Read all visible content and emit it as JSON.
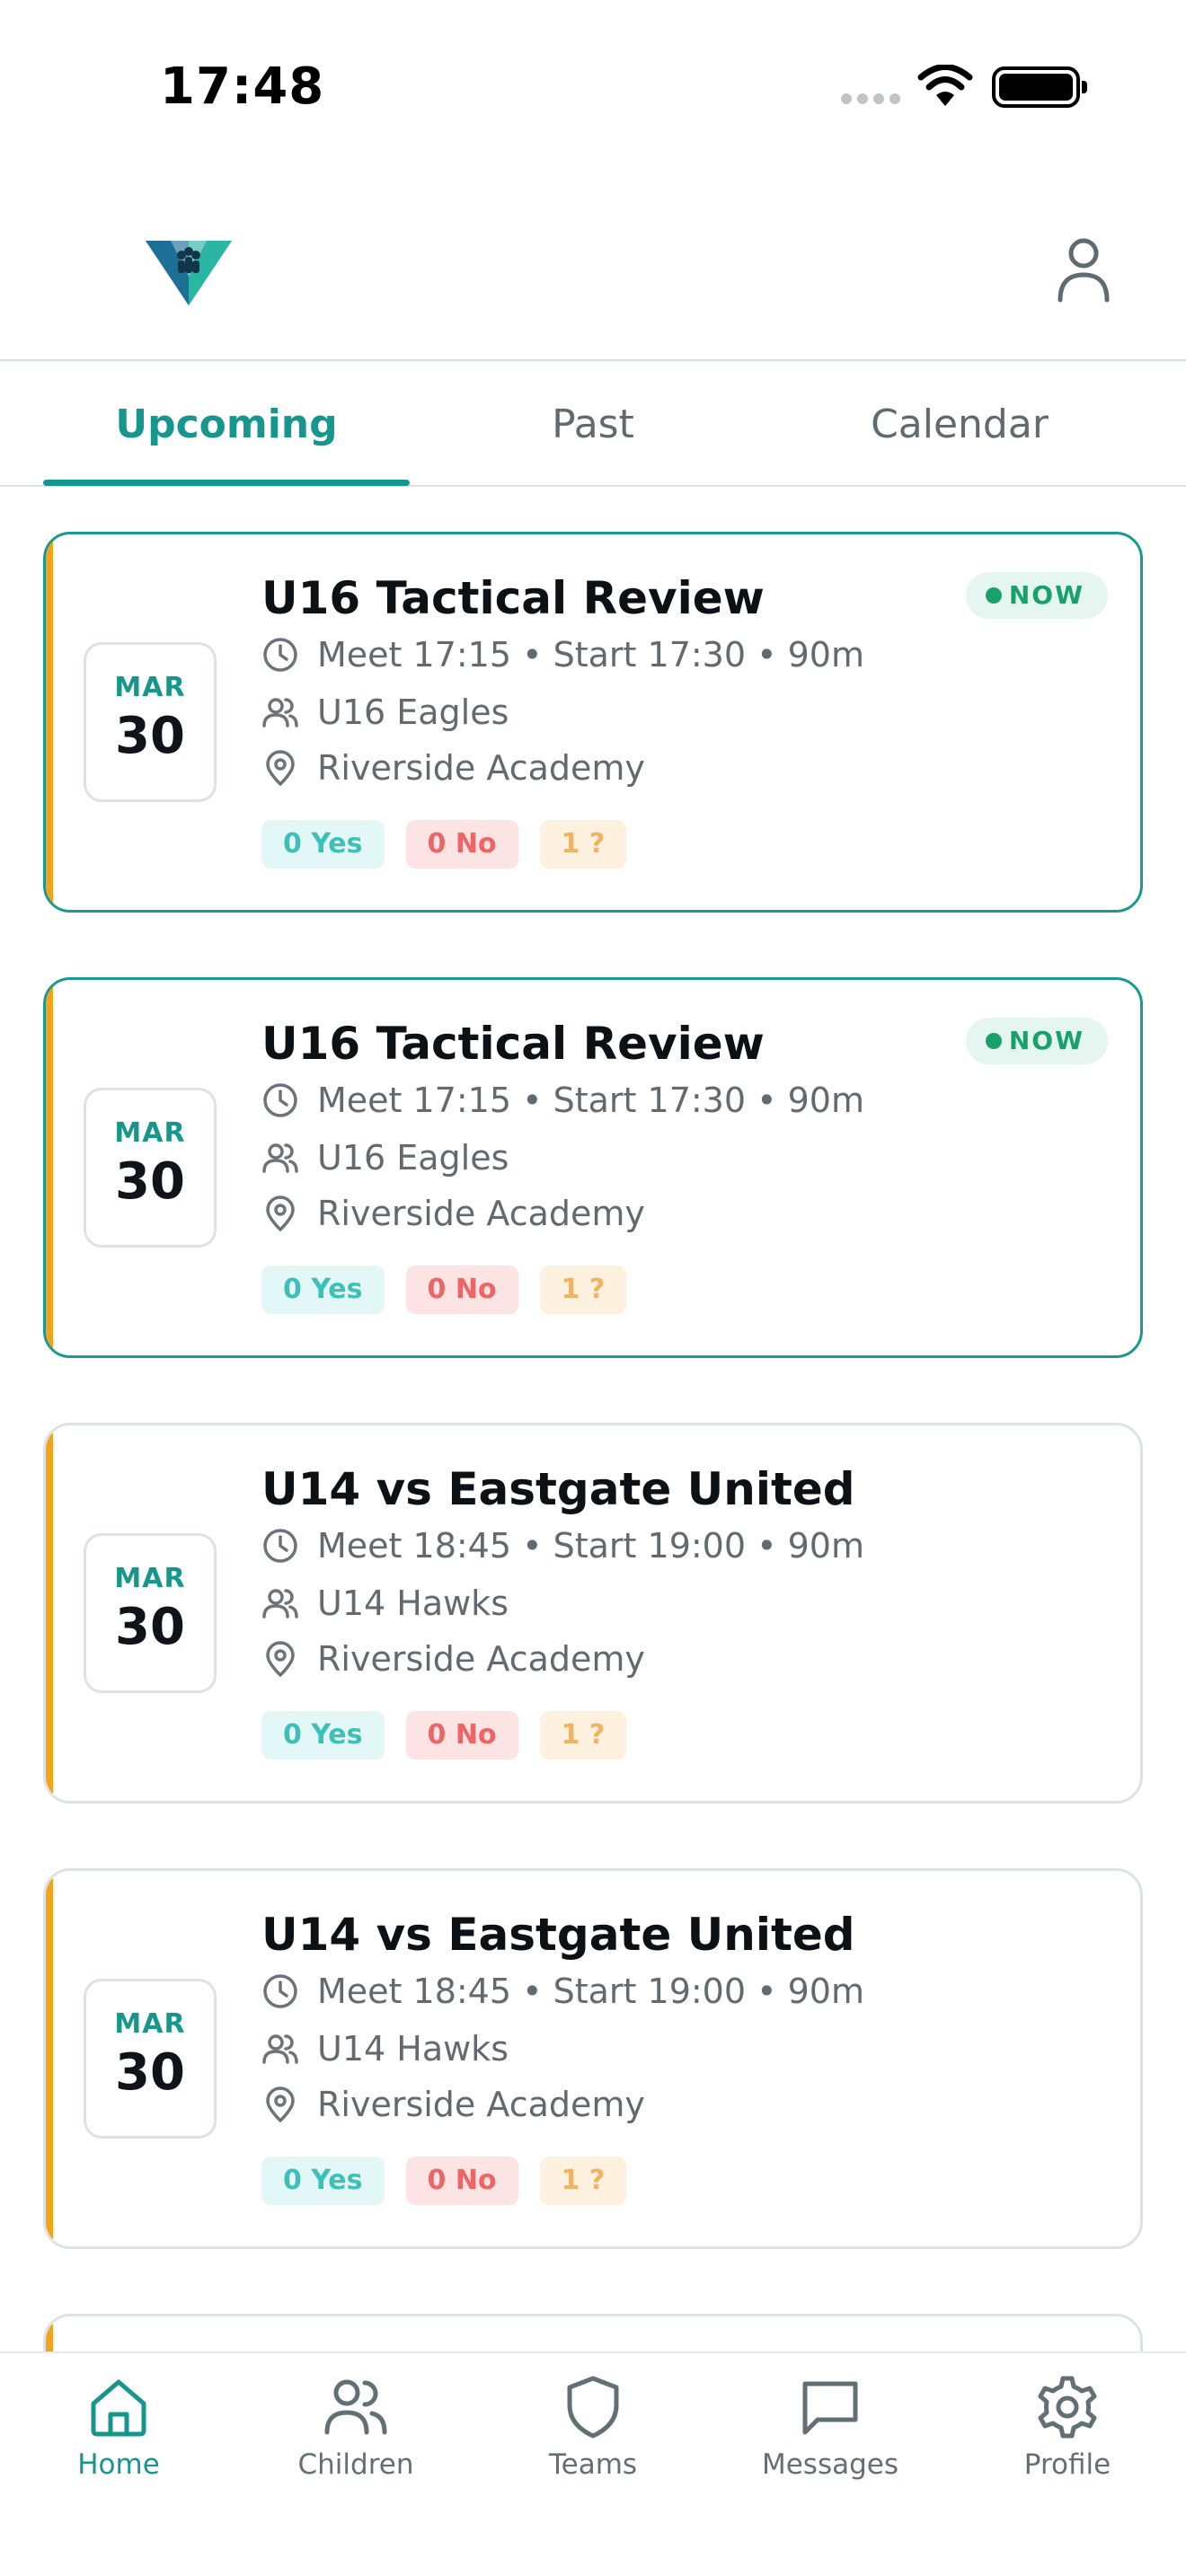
{
  "status_bar": {
    "time": "17:48"
  },
  "tabs": [
    {
      "label": "Upcoming",
      "active": true
    },
    {
      "label": "Past",
      "active": false
    },
    {
      "label": "Calendar",
      "active": false
    }
  ],
  "events": [
    {
      "month": "MAR",
      "day": "30",
      "title": "U16 Tactical Review",
      "badge": "NOW",
      "time": "Meet 17:15 • Start 17:30 • 90m",
      "team": "U16 Eagles",
      "location": "Riverside Academy",
      "yes": "0 Yes",
      "no": "0 No",
      "maybe": "1 ?"
    },
    {
      "month": "MAR",
      "day": "30",
      "title": "U16 Tactical Review",
      "badge": "NOW",
      "time": "Meet 17:15 • Start 17:30 • 90m",
      "team": "U16 Eagles",
      "location": "Riverside Academy",
      "yes": "0 Yes",
      "no": "0 No",
      "maybe": "1 ?"
    },
    {
      "month": "MAR",
      "day": "30",
      "title": "U14 vs Eastgate United",
      "badge": "",
      "time": "Meet 18:45 • Start 19:00 • 90m",
      "team": "U14 Hawks",
      "location": "Riverside Academy",
      "yes": "0 Yes",
      "no": "0 No",
      "maybe": "1 ?"
    },
    {
      "month": "MAR",
      "day": "30",
      "title": "U14 vs Eastgate United",
      "badge": "",
      "time": "Meet 18:45 • Start 19:00 • 90m",
      "team": "U14 Hawks",
      "location": "Riverside Academy",
      "yes": "0 Yes",
      "no": "0 No",
      "maybe": "1 ?"
    }
  ],
  "bottom_nav": [
    {
      "label": "Home",
      "icon": "home-icon",
      "active": true
    },
    {
      "label": "Children",
      "icon": "children-icon",
      "active": false
    },
    {
      "label": "Teams",
      "icon": "shield-icon",
      "active": false
    },
    {
      "label": "Messages",
      "icon": "message-icon",
      "active": false
    },
    {
      "label": "Profile",
      "icon": "gear-icon",
      "active": false
    }
  ],
  "colors": {
    "primary": "#16968c",
    "accent": "#f3a21a",
    "now": "#19a16c",
    "yes": "#3cc0b7",
    "no": "#ef6464",
    "maybe": "#f5b361"
  }
}
